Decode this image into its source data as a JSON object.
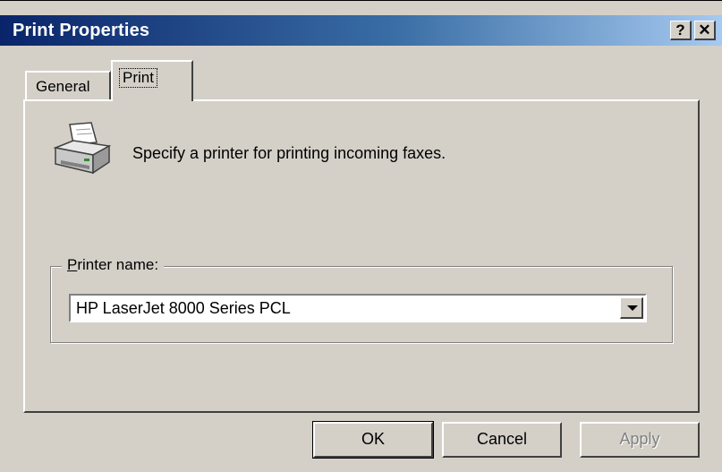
{
  "window": {
    "title": "Print Properties",
    "help_label": "?",
    "close_label": "✕"
  },
  "tabs": [
    {
      "label": "General",
      "active": false
    },
    {
      "label": "Print",
      "active": true
    }
  ],
  "panel": {
    "description": "Specify a printer for printing incoming faxes.",
    "icon": "printer-icon"
  },
  "printer_group": {
    "label_prefix": "",
    "label_accel": "P",
    "label_rest": "rinter name:",
    "selected_value": "HP LaserJet 8000 Series PCL"
  },
  "buttons": {
    "ok": "OK",
    "cancel": "Cancel",
    "apply": "Apply"
  }
}
